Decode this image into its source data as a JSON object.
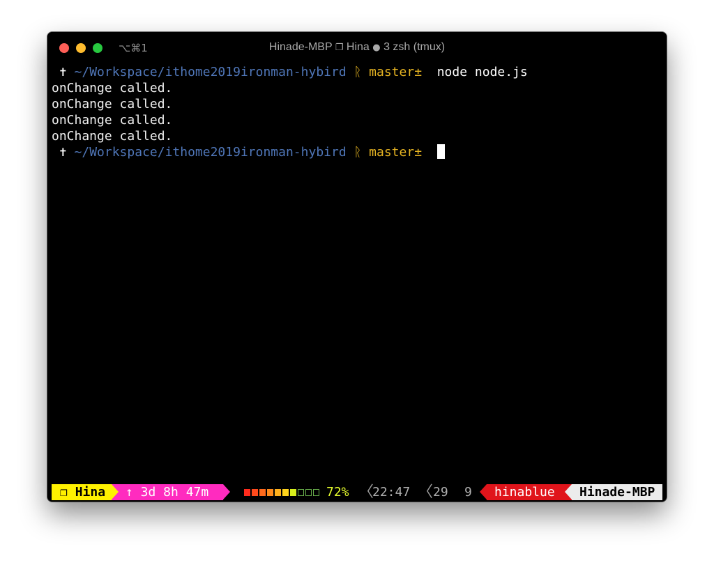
{
  "window": {
    "shortcut": "⌥⌘1",
    "title_host": "Hinade-MBP",
    "title_session_icon": "❐",
    "title_session": "Hina",
    "title_dot": "●",
    "title_window": "3 zsh (tmux)"
  },
  "terminal": {
    "prompt": {
      "symbol": "✝",
      "path": "~/Workspace/ithome2019ironman-hybird",
      "branch_icon": "ᚱ",
      "branch_icon_name": "git-branch-icon",
      "branch": "master±"
    },
    "command": "node node.js",
    "output": [
      "onChange called.",
      "onChange called.",
      "onChange called.",
      "onChange called."
    ]
  },
  "statusbar": {
    "session_icon": "❐",
    "session": "Hina",
    "uptime": "↑ 3d 8h 47m",
    "battery": {
      "level": 0.72,
      "label": "72%",
      "cells": 10,
      "filled": 7,
      "cell_colors": [
        "#ff2b1c",
        "#ff4a1c",
        "#ff6a1c",
        "#ff8a1c",
        "#ffb01c",
        "#ffd41c",
        "#d8f01c"
      ]
    },
    "separator": "〈",
    "clock": "22:47",
    "count1": "29",
    "count2": "9",
    "user": "hinablue",
    "host": "Hinade-MBP"
  },
  "colors": {
    "session_bg": "#fff100",
    "uptime_bg": "#ff2bbf",
    "user_bg": "#e0141b",
    "host_bg": "#ececec",
    "path": "#4f76b8",
    "branch": "#e6b422"
  }
}
